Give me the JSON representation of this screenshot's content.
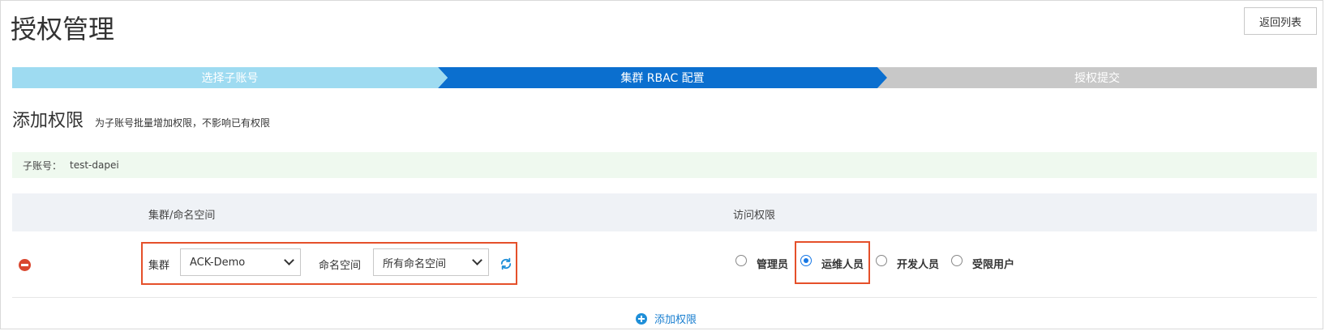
{
  "page": {
    "title": "授权管理",
    "back_button": "返回列表"
  },
  "steps": [
    {
      "label": "选择子账号",
      "state": "done"
    },
    {
      "label": "集群 RBAC 配置",
      "state": "active"
    },
    {
      "label": "授权提交",
      "state": "pending"
    }
  ],
  "section": {
    "title": "添加权限",
    "description": "为子账号批量增加权限，不影响已有权限"
  },
  "account": {
    "label": "子账号：",
    "value": "test-dapei"
  },
  "table": {
    "headers": {
      "namespace_col": "集群/命名空间",
      "permission_col": "访问权限"
    },
    "rows": [
      {
        "cluster_label": "集群",
        "cluster_value": "ACK-Demo",
        "namespace_label": "命名空间",
        "namespace_value": "所有命名空间",
        "roles": [
          {
            "label": "管理员",
            "checked": false
          },
          {
            "label": "运维人员",
            "checked": true
          },
          {
            "label": "开发人员",
            "checked": false
          },
          {
            "label": "受限用户",
            "checked": false
          }
        ]
      }
    ]
  },
  "add_permission": "添加权限",
  "colors": {
    "step_done": "#9edbf1",
    "step_active": "#0b6fcf",
    "step_pending": "#c8c8c8",
    "highlight": "#e5502a",
    "link": "#1a7fd0",
    "danger": "#d9472f"
  },
  "icons": {
    "remove": "minus-circle-icon",
    "refresh": "refresh-icon",
    "add": "plus-circle-icon",
    "select_arrow": "chevron-down-icon"
  }
}
